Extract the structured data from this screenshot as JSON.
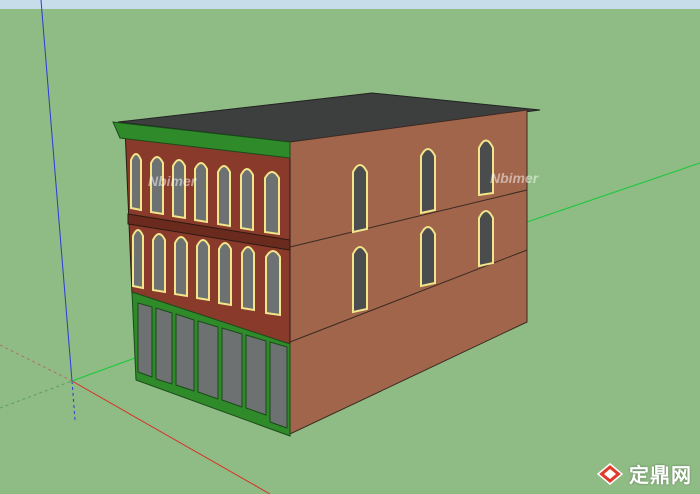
{
  "app": {
    "canvas_background": "#8fbb84",
    "sky_color": "#c7dde9"
  },
  "watermarks": {
    "nbimer_label": "Nbimer",
    "site_label": "定鼎网",
    "logo_icon": "diamond-logo-icon"
  },
  "colors": {
    "axis_blue": "#2a3bd6",
    "axis_red": "#d8302a",
    "axis_green": "#18c93a",
    "roof": "#3d3f3f",
    "brick": "#a0654a",
    "facade_red": "#8a3a2a",
    "trim_green": "#2f8a2a",
    "glass": "#6d7172",
    "arch_yellow": "#f2e58a"
  }
}
